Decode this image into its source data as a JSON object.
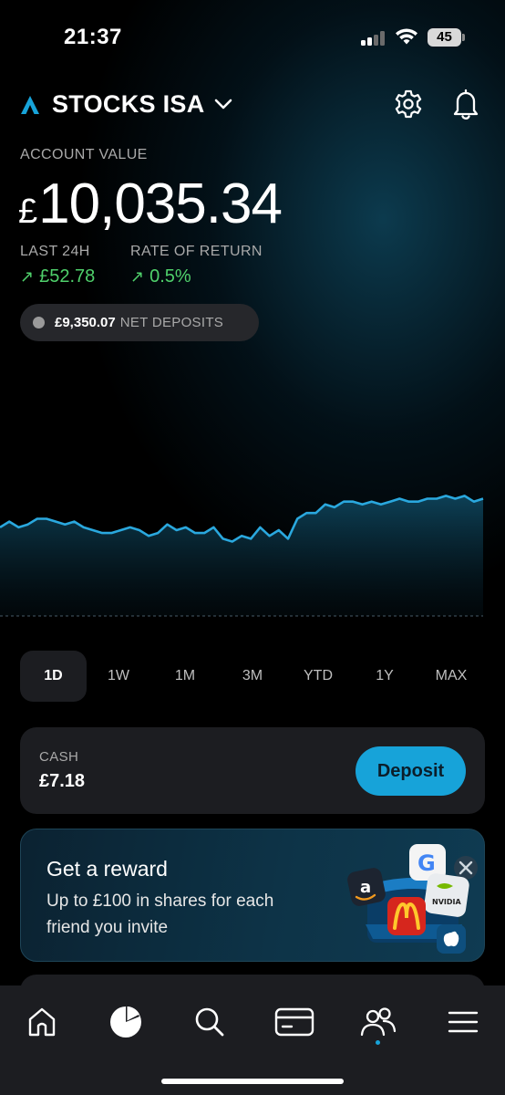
{
  "status_bar": {
    "time": "21:37",
    "battery": "45"
  },
  "header": {
    "account_name": "STOCKS ISA"
  },
  "summary": {
    "account_value_label": "ACCOUNT VALUE",
    "currency_symbol": "£",
    "account_value": "10,035.34",
    "last24_label": "LAST 24H",
    "last24_value": "£52.78",
    "rate_of_return_label": "RATE OF RETURN",
    "rate_of_return_value": "0.5%",
    "gain_arrow": "↗",
    "net_deposits_amount": "£9,350.07",
    "net_deposits_label": "NET DEPOSITS"
  },
  "colors": {
    "accent": "#17a3d9",
    "positive": "#4fd06b",
    "chart_line": "#2aa8de",
    "card_bg": "#1c1d21"
  },
  "chart_data": {
    "type": "area",
    "title": "",
    "xlabel": "",
    "ylabel": "",
    "grid": false,
    "ylim": [
      9985,
      10060
    ],
    "series": [
      {
        "values": [
          10016,
          10018,
          10016,
          10017,
          10019,
          10019,
          10018,
          10017,
          10018,
          10016,
          10015,
          10014,
          10014,
          10015,
          10016,
          10015,
          10013,
          10014,
          10017,
          10015,
          10016,
          10014,
          10014,
          10016,
          10012,
          10011,
          10013,
          10012,
          10016,
          10013,
          10015,
          10012,
          10019,
          10021,
          10021,
          10024,
          10023,
          10025,
          10025,
          10024,
          10025,
          10024,
          10025,
          10026,
          10025,
          10025,
          10026,
          10026,
          10027,
          10026,
          10027,
          10025,
          10026
        ]
      }
    ]
  },
  "range_tabs": [
    "1D",
    "1W",
    "1M",
    "3M",
    "YTD",
    "1Y",
    "MAX"
  ],
  "range_selected": "1D",
  "cash": {
    "label": "CASH",
    "value": "£7.18",
    "button_label": "Deposit"
  },
  "reward": {
    "title": "Get a reward",
    "description": "Up to £100 in shares for each friend you invite",
    "art_icons": [
      "amazon-icon",
      "google-icon",
      "nvidia-icon",
      "mcdonalds-icon",
      "apple-icon"
    ]
  },
  "tab_bar": {
    "items": [
      "home-icon",
      "portfolio-pie-icon",
      "search-icon",
      "card-icon",
      "friends-icon",
      "menu-icon"
    ],
    "active": "portfolio-pie-icon"
  }
}
